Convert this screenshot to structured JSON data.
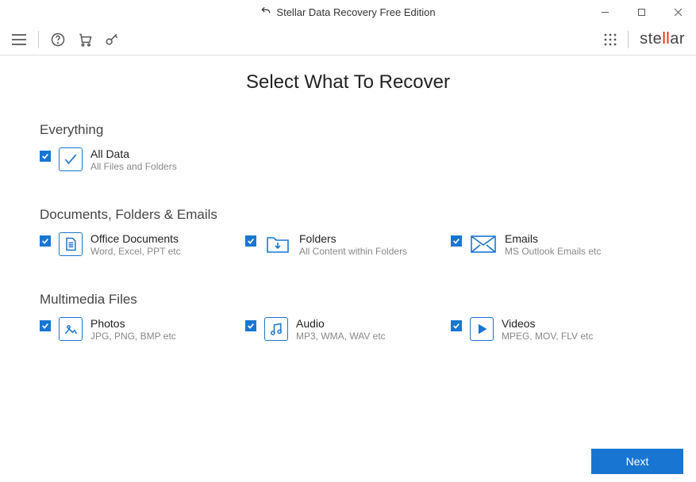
{
  "window": {
    "title": "Stellar Data Recovery Free Edition"
  },
  "brand": "stellar",
  "page": {
    "title": "Select What To Recover"
  },
  "sections": {
    "everything": {
      "label": "Everything",
      "items": [
        {
          "title": "All Data",
          "desc": "All Files and Folders"
        }
      ]
    },
    "documents": {
      "label": "Documents, Folders & Emails",
      "items": [
        {
          "title": "Office Documents",
          "desc": "Word, Excel, PPT etc"
        },
        {
          "title": "Folders",
          "desc": "All Content within Folders"
        },
        {
          "title": "Emails",
          "desc": "MS Outlook Emails etc"
        }
      ]
    },
    "multimedia": {
      "label": "Multimedia Files",
      "items": [
        {
          "title": "Photos",
          "desc": "JPG, PNG, BMP etc"
        },
        {
          "title": "Audio",
          "desc": "MP3, WMA, WAV etc"
        },
        {
          "title": "Videos",
          "desc": "MPEG, MOV, FLV etc"
        }
      ]
    }
  },
  "footer": {
    "next": "Next"
  }
}
